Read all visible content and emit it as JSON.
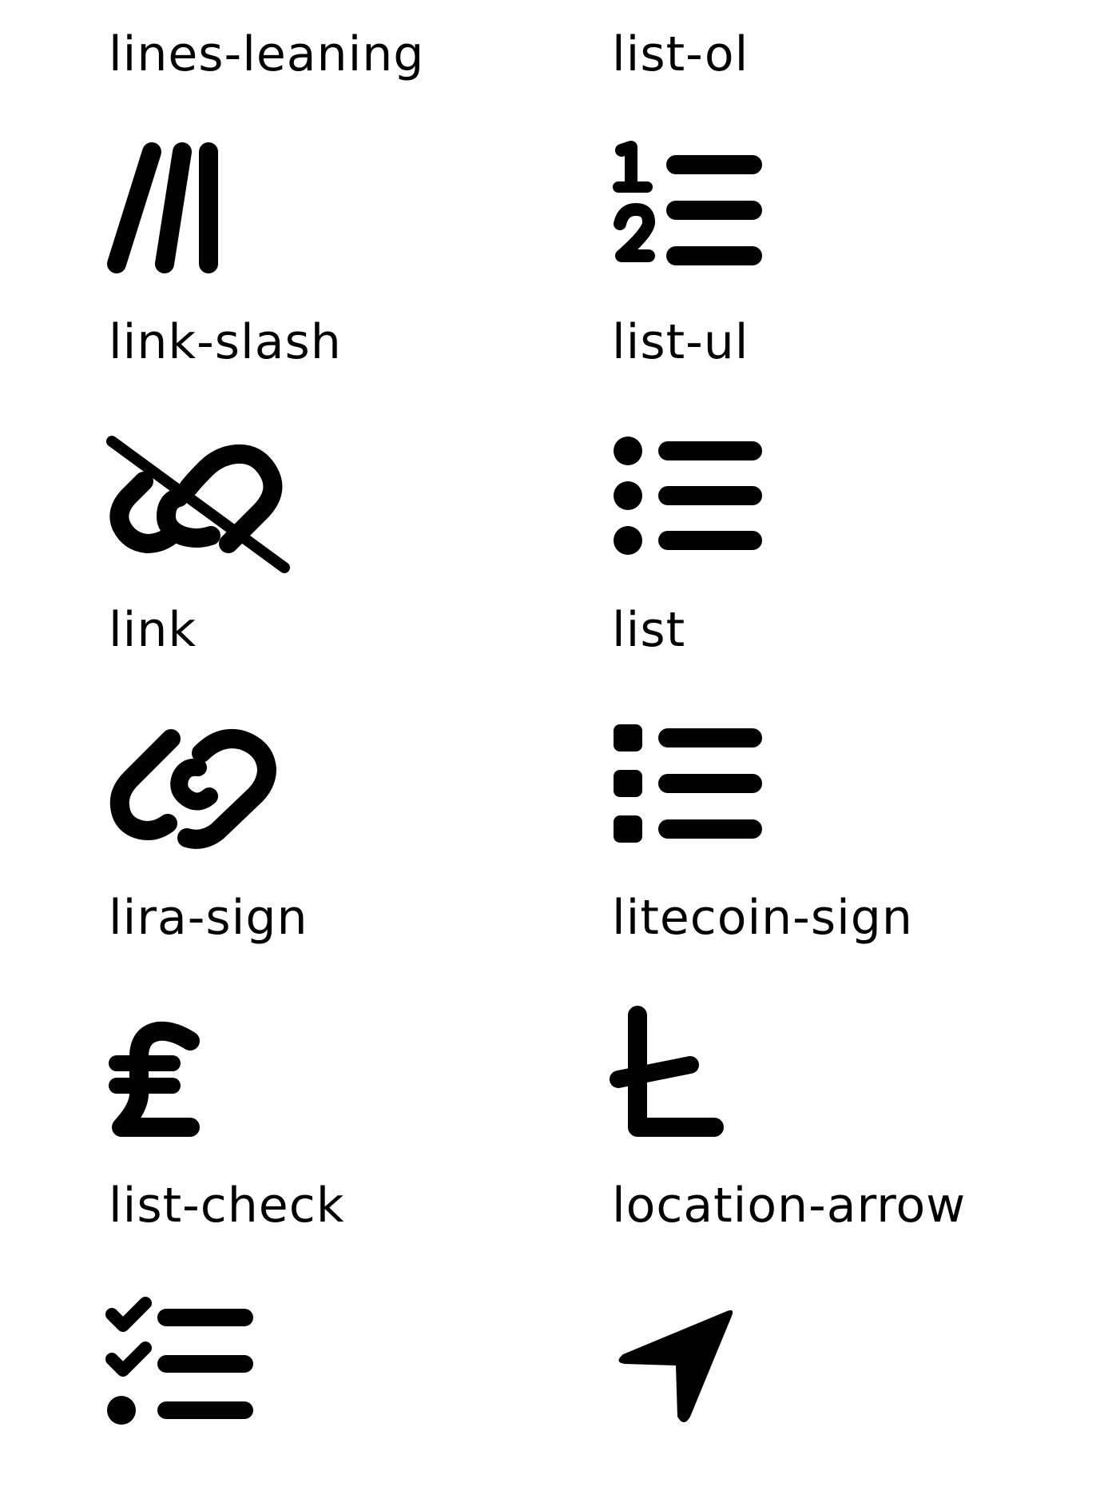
{
  "icons": [
    {
      "label": "lines-leaning",
      "icon": "lines-leaning-icon"
    },
    {
      "label": "list-ol",
      "icon": "list-ol-icon"
    },
    {
      "label": "link-slash",
      "icon": "link-slash-icon"
    },
    {
      "label": "list-ul",
      "icon": "list-ul-icon"
    },
    {
      "label": "link",
      "icon": "link-icon"
    },
    {
      "label": "list",
      "icon": "list-icon"
    },
    {
      "label": "lira-sign",
      "icon": "lira-sign-icon"
    },
    {
      "label": "litecoin-sign",
      "icon": "litecoin-sign-icon"
    },
    {
      "label": "list-check",
      "icon": "list-check-icon"
    },
    {
      "label": "location-arrow",
      "icon": "location-arrow-icon"
    }
  ]
}
